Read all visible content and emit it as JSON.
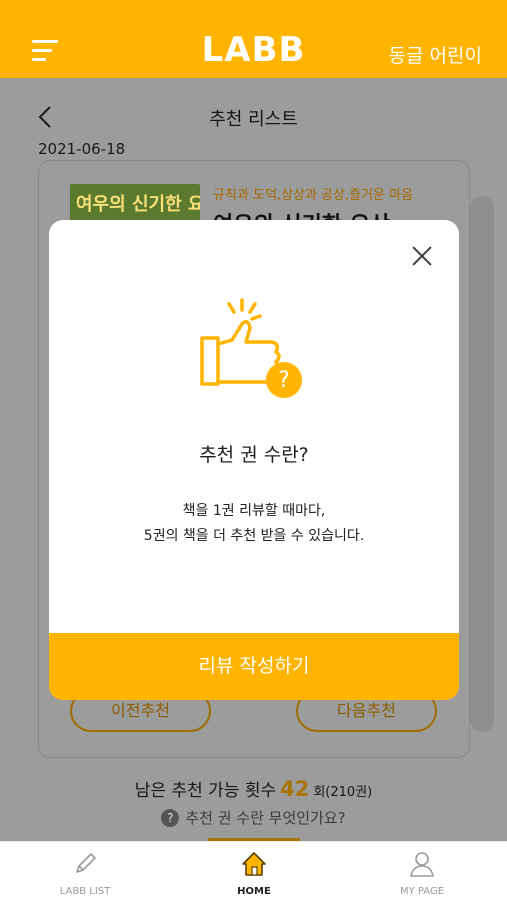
{
  "header": {
    "logo": "LABB",
    "user_name": "동글 어린이"
  },
  "page": {
    "title": "추천 리스트",
    "date": "2021-06-18",
    "book": {
      "cover_title": "여우의 신기한 요산",
      "tags": "규칙과 도덕,상상과 공상,즐거운 마음",
      "title": "여우의 신기한 요산"
    },
    "prev_label": "이전추천",
    "next_label": "다음추천",
    "remaining_label": "남은 추천 가능 횟수",
    "remaining_count": "42",
    "remaining_unit": "회(210권)",
    "help_icon": "?",
    "help_text": "추천 권 수란 무엇인가요?"
  },
  "modal": {
    "title": "추천 권 수란?",
    "line1": "책을 1권 리뷰할 때마다,",
    "line2": "5권의 책을 더 추천 받을 수 있습니다.",
    "button_label": "리뷰 작성하기",
    "icon": "thumbs-up-question-icon"
  },
  "bottom_nav": {
    "items": [
      {
        "label": "LABB LIST",
        "icon": "pencil-icon"
      },
      {
        "label": "HOME",
        "icon": "home-icon"
      },
      {
        "label": "MY PAGE",
        "icon": "person-icon"
      }
    ]
  },
  "colors": {
    "brand": "#ffb400",
    "overlay": "#9c9c9c",
    "modal_bg": "#ffffff"
  }
}
